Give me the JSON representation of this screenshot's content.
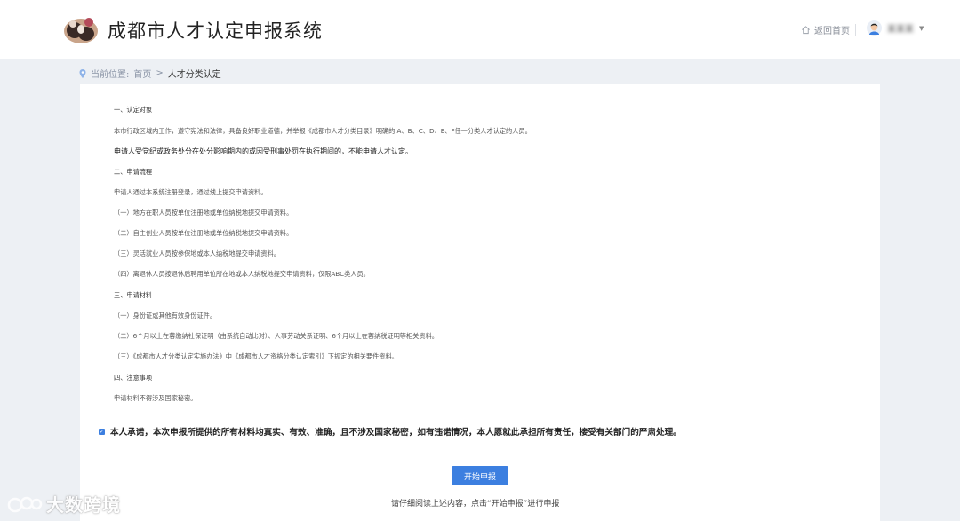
{
  "header": {
    "app_title": "成都市人才认定申报系统",
    "home_label": "返回首页",
    "user_name": "某某某"
  },
  "breadcrumb": {
    "prefix": "当前位置:",
    "home": "首页",
    "separator": ">",
    "current": "人才分类认定"
  },
  "content": {
    "lines": [
      "一、认定对象",
      "本市行政区域内工作，遵守宪法和法律，具备良好职业道德，并举报《成都市人才分类目录》明确的 A、B、C、D、E、F任一分类人才认定的人员。",
      "申请人受党纪或政务处分在处分影响期内的或因受刑事处罚在执行期间的，不能申请人才认定。",
      "二、申请流程",
      "申请人通过本系统注册登录，通过线上提交申请资料。",
      "（一）地方在职人员按单位注册地或单位纳税地提交申请资料。",
      "（二）自主创业人员按单位注册地或单位纳税地提交申请资料。",
      "（三）灵活就业人员按参保地或本人纳税地提交申请资料。",
      "（四）离退休人员按退休后聘用单位所在地或本人纳税地提交申请资料，仅限ABC类人员。",
      "三、申请材料",
      "（一）身份证或其他有效身份证件。",
      "（二）6个月以上在蓉缴纳社保证明（由系统自动比对）、人事劳动关系证明、6个月以上在蓉纳税证明等相关资料。",
      "（三）《成都市人才分类认定实施办法》中《成都市人才资格分类认定索引》下规定的相关要件资料。",
      "四、注意事项",
      "申请材料不得涉及国家秘密。"
    ],
    "agreement": "本人承诺，本次申报所提供的所有材料均真实、有效、准确，且不涉及国家秘密，如有违诺情况，本人愿就此承担所有责任，接受有关部门的严肃处理。",
    "agreement_checked": true,
    "start_button": "开始申报",
    "hint": "请仔细阅读上述内容，点击“开始申报”进行申报"
  },
  "watermark": "大数跨境",
  "colors": {
    "accent": "#3c7fe0",
    "background": "#edf0f4"
  }
}
